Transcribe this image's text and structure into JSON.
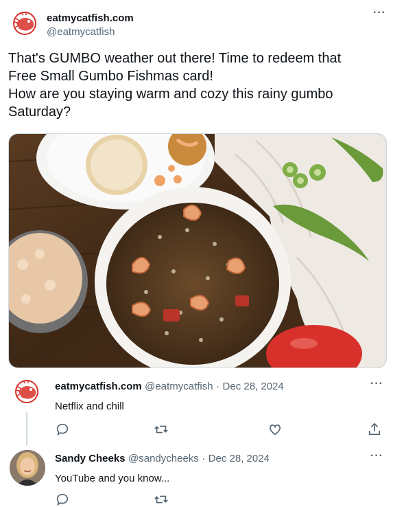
{
  "main_tweet": {
    "display_name": "eatmycatfish.com",
    "handle": "@eatmycatfish",
    "text_lines": [
      "That's GUMBO weather out there! Time to redeem that",
      "Free Small Gumbo Fishmas card!",
      "How are you staying warm and cozy this rainy gumbo",
      "Saturday?"
    ],
    "more_icon": "more-dots-icon"
  },
  "replies": [
    {
      "display_name": "eatmycatfish.com",
      "handle": "@eatmycatfish",
      "separator": "·",
      "date": "Dec 28, 2024",
      "text": "Netflix and chill"
    },
    {
      "display_name": "Sandy Cheeks",
      "handle": "@sandycheeks",
      "separator": "·",
      "date": "Dec 28, 2024",
      "text": "YouTube and you know..."
    }
  ],
  "actions": [
    "reply-icon",
    "retweet-icon",
    "like-icon",
    "share-icon"
  ],
  "colors": {
    "text_primary": "#0f1419",
    "text_secondary": "#536471",
    "brand_red": "#d8302a",
    "border": "#cfd9de"
  }
}
